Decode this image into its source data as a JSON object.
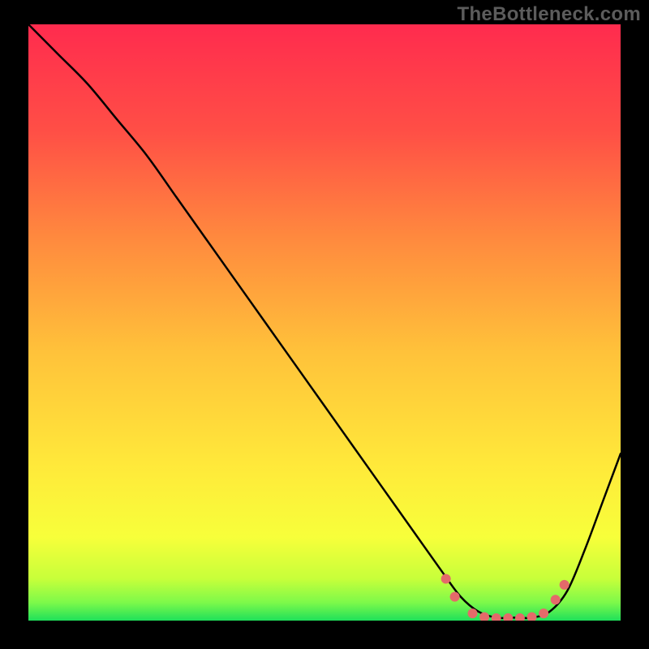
{
  "watermark": {
    "text": "TheBottleneck.com"
  },
  "chart_data": {
    "type": "line",
    "title": "",
    "xlabel": "",
    "ylabel": "",
    "xlim": [
      0,
      100
    ],
    "ylim": [
      0,
      100
    ],
    "grid": false,
    "legend": false,
    "background_gradient": {
      "top_color": "#ff2b4e",
      "upper_mid_color": "#ff7a3e",
      "mid_color": "#ffd23a",
      "lower_mid_color": "#fff33a",
      "bottom_color": "#1fe05a"
    },
    "series": [
      {
        "name": "bottleneck-curve",
        "color": "#000000",
        "x": [
          0,
          5,
          10,
          15,
          20,
          25,
          30,
          35,
          40,
          45,
          50,
          55,
          60,
          65,
          70,
          73,
          76,
          79,
          82,
          85,
          88,
          91,
          94,
          97,
          100
        ],
        "y": [
          100,
          95,
          90,
          84,
          78,
          71,
          64,
          57,
          50,
          43,
          36,
          29,
          22,
          15,
          8,
          4,
          1.5,
          0.5,
          0.5,
          0.5,
          1.5,
          5,
          12,
          20,
          28
        ]
      },
      {
        "name": "optimal-zone-markers",
        "type": "scatter",
        "color": "#e46a6a",
        "marker_size": 8,
        "x": [
          70.5,
          72,
          75,
          77,
          79,
          81,
          83,
          85,
          87,
          89,
          90.5
        ],
        "y": [
          7.0,
          4.0,
          1.2,
          0.6,
          0.4,
          0.4,
          0.4,
          0.6,
          1.2,
          3.5,
          6.0
        ]
      }
    ]
  }
}
